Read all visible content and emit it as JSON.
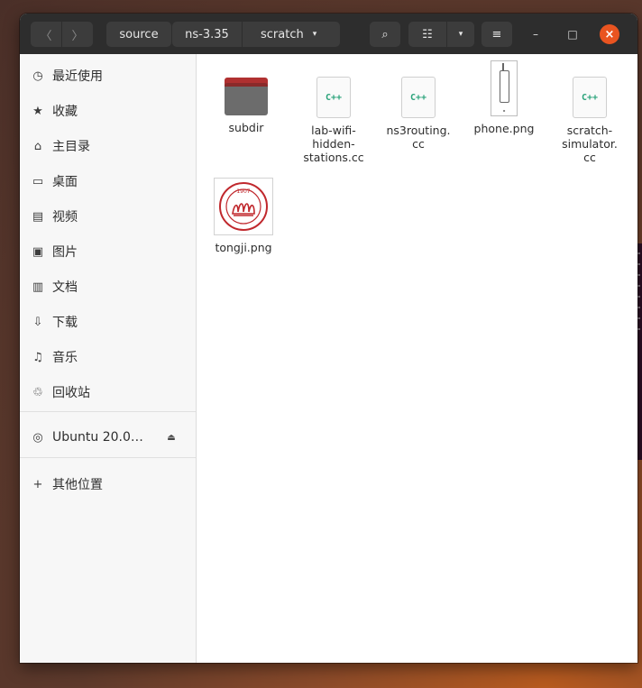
{
  "header": {
    "back_glyph": "〈",
    "forward_glyph": "〉",
    "breadcrumbs": [
      "source",
      "ns-3.35",
      "scratch"
    ],
    "caret_glyph": "▾",
    "search_glyph": "⌕",
    "view_glyph": "☷",
    "menu_glyph": "≡",
    "minimize_glyph": "–",
    "maximize_glyph": "□",
    "close_glyph": "×",
    "accent": "#e95420"
  },
  "sidebar": {
    "items": [
      {
        "icon": "clock-icon",
        "glyph": "◷",
        "label": "最近使用"
      },
      {
        "icon": "star-icon",
        "glyph": "★",
        "label": "收藏"
      },
      {
        "icon": "home-icon",
        "glyph": "⌂",
        "label": "主目录"
      },
      {
        "icon": "desktop-icon",
        "glyph": "▭",
        "label": "桌面"
      },
      {
        "icon": "video-icon",
        "glyph": "▤",
        "label": "视频"
      },
      {
        "icon": "picture-icon",
        "glyph": "▣",
        "label": "图片"
      },
      {
        "icon": "document-icon",
        "glyph": "▥",
        "label": "文档"
      },
      {
        "icon": "download-icon",
        "glyph": "⇩",
        "label": "下载"
      },
      {
        "icon": "music-icon",
        "glyph": "♫",
        "label": "音乐"
      },
      {
        "icon": "trash-icon",
        "glyph": "♲",
        "label": "回收站"
      },
      {
        "icon": "disc-icon",
        "glyph": "◎",
        "label": "Ubuntu 20.0…",
        "eject_glyph": "⏏"
      },
      {
        "icon": "plus-icon",
        "glyph": "+",
        "label": "其他位置"
      }
    ]
  },
  "files": [
    {
      "name": "subdir",
      "kind": "folder"
    },
    {
      "name": "lab-wifi-hidden-stations.cc",
      "display": [
        "lab-wifi-",
        "hidden-",
        "stations.cc"
      ],
      "kind": "cpp",
      "badge": "C++"
    },
    {
      "name": "ns3routing.cc",
      "display": [
        "ns3routing.",
        "cc"
      ],
      "kind": "cpp",
      "badge": "C++"
    },
    {
      "name": "phone.png",
      "display": [
        "phone.png"
      ],
      "kind": "image"
    },
    {
      "name": "scratch-simulator.cc",
      "display": [
        "scratch-",
        "simulator.",
        "cc"
      ],
      "kind": "cpp",
      "badge": "C++"
    },
    {
      "name": "tongji.png",
      "display": [
        "tongji.png"
      ],
      "kind": "image",
      "seal_text": "1907"
    }
  ]
}
